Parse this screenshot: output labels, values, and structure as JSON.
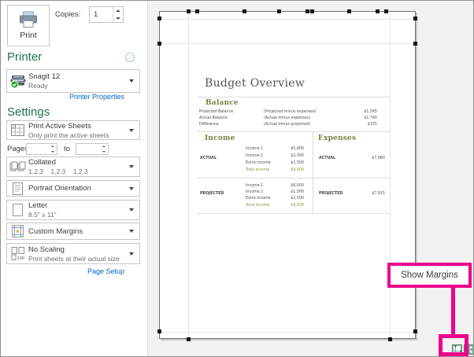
{
  "colors": {
    "accent_green": "#217346",
    "link_blue": "#0563c1",
    "callout_magenta": "#ec008c",
    "sheet_olive": "#7c8140",
    "total_green": "#7f9a3e"
  },
  "print": {
    "button_label": "Print",
    "copies_label": "Copies:",
    "copies_value": "1"
  },
  "printer": {
    "heading": "Printer",
    "name": "Snagit 12",
    "status": "Ready",
    "properties_link": "Printer Properties"
  },
  "settings": {
    "heading": "Settings",
    "what_to_print": {
      "label": "Print Active Sheets",
      "sublabel": "Only print the active sheets"
    },
    "pages": {
      "label": "Pages:",
      "to_label": "to",
      "from_value": "",
      "to_value": ""
    },
    "collation": {
      "label": "Collated",
      "sublabel": "1,2,3    1,2,3    1,2,3"
    },
    "orientation": {
      "label": "Portrait Orientation"
    },
    "paper": {
      "label": "Letter",
      "sublabel": "8.5\" x 11\""
    },
    "margins": {
      "label": "Custom Margins"
    },
    "scaling": {
      "label": "No Scaling",
      "sublabel": "Print sheets at their actual size"
    },
    "page_setup_link": "Page Setup"
  },
  "preview": {
    "sheet": {
      "title": "Budget Overview",
      "balance": {
        "heading": "Balance",
        "rows": [
          {
            "label": "Projected Balance",
            "formula": "(Projected minus expenses)",
            "value": "$1,585"
          },
          {
            "label": "Actual Balance",
            "formula": "(Actual minus expenses)",
            "value": "$1,740"
          },
          {
            "label": "Difference",
            "formula": "(Actual minus projected)",
            "value": "$155"
          }
        ]
      },
      "income": {
        "heading": "Income",
        "groups": [
          {
            "name": "ACTUAL",
            "rows": [
              {
                "label": "Income 1",
                "value": "$5,800"
              },
              {
                "label": "Income 2",
                "value": "$2,300"
              },
              {
                "label": "Extra income",
                "value": "$1,500"
              },
              {
                "label": "Total income",
                "value": "$9,600"
              }
            ]
          },
          {
            "name": "PROJECTED",
            "rows": [
              {
                "label": "Income 1",
                "value": "$6,000"
              },
              {
                "label": "Income 2",
                "value": "$1,000"
              },
              {
                "label": "Extra income",
                "value": "$2,500"
              },
              {
                "label": "Total income",
                "value": "$9,500"
              }
            ]
          }
        ]
      },
      "expenses": {
        "heading": "Expenses",
        "groups": [
          {
            "name": "ACTUAL",
            "value": "$7,860"
          },
          {
            "name": "PROJECTED",
            "value": "$7,915"
          }
        ]
      }
    }
  },
  "callout": {
    "label": "Show Margins"
  }
}
